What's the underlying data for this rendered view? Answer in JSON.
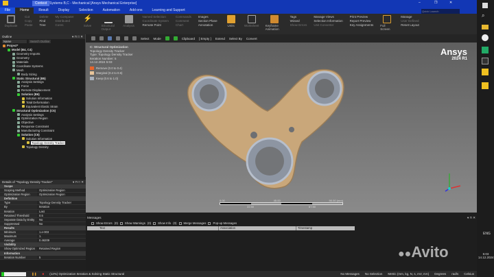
{
  "window": {
    "title": "Systems B,C - Mechanical [Ansys Mechanical Enterprise]",
    "context_tab": "Context",
    "quick_launch_placeholder": "Quick Launch"
  },
  "menu_tabs": [
    "File",
    "Home",
    "Result",
    "Display",
    "Selection",
    "Automation",
    "Add-ons",
    "Learning and Support"
  ],
  "ribbon": {
    "outline_group": {
      "label": "Outline",
      "items": [
        "Duplicate",
        "Cut",
        "Copy",
        "Paste",
        "Delete",
        "Find",
        "Tree"
      ]
    },
    "solve_group": {
      "label": "Solve",
      "items": [
        "My Computer",
        "Distributed",
        "Cores",
        "Solve",
        "Structural Output",
        "Analysis"
      ]
    },
    "insert_group": {
      "label": "Insert",
      "items": [
        "Named Selection",
        "Coordinate System",
        "Remote Point",
        "Commands",
        "Comment",
        "Chart",
        "Images",
        "Section Plane",
        "Annotation"
      ]
    },
    "tools_group": {
      "label": "Tools",
      "items": [
        "Units",
        "Worksheet",
        "Keyframe Animation",
        "Tags",
        "Wizard",
        "Show Errors",
        "Manage Views",
        "Selection Information",
        "Unit Converter",
        "Print Preview",
        "Report Preview",
        "Key Assignments"
      ]
    },
    "layout_group": {
      "label": "Layout",
      "items": [
        "Full Screen",
        "Manage",
        "User Defined",
        "Reset Layout"
      ]
    }
  },
  "toolbar": {
    "select": "Select",
    "mode": "Mode",
    "clipboard": "Clipboard",
    "empty": "[ Empty ]",
    "extend": "Extend",
    "select_by": "Select By",
    "convert": "Convert"
  },
  "outline": {
    "title": "Outline",
    "name_filter": "Name",
    "search_placeholder": "Search Outline",
    "tree": [
      {
        "label": "Project*",
        "level": 0,
        "bold": true
      },
      {
        "label": "Model (B4, C4)",
        "level": 1,
        "bold": true
      },
      {
        "label": "Geometry Imports",
        "level": 2
      },
      {
        "label": "Geometry",
        "level": 2
      },
      {
        "label": "Materials",
        "level": 2
      },
      {
        "label": "Coordinate Systems",
        "level": 2
      },
      {
        "label": "Mesh",
        "level": 2
      },
      {
        "label": "Body Sizing",
        "level": 3
      },
      {
        "label": "Static Structural (B5)",
        "level": 2,
        "bold": true
      },
      {
        "label": "Analysis Settings",
        "level": 3
      },
      {
        "label": "Force",
        "level": 3
      },
      {
        "label": "Remote Displacement",
        "level": 3
      },
      {
        "label": "Solution (B6)",
        "level": 3,
        "bold": true
      },
      {
        "label": "Solution Information",
        "level": 4
      },
      {
        "label": "Total Deformation",
        "level": 4
      },
      {
        "label": "Equivalent Elastic Strain",
        "level": 4
      },
      {
        "label": "Structural Optimization (C5)",
        "level": 2,
        "bold": true
      },
      {
        "label": "Analysis Settings",
        "level": 3
      },
      {
        "label": "Optimization Region",
        "level": 3
      },
      {
        "label": "Objective",
        "level": 3
      },
      {
        "label": "Response Constraint",
        "level": 3
      },
      {
        "label": "Manufacturing Constraint",
        "level": 3
      },
      {
        "label": "Solution (C6)",
        "level": 3,
        "bold": true
      },
      {
        "label": "Solution Information",
        "level": 4
      },
      {
        "label": "Topology Density Tracker",
        "level": 5,
        "selected": true
      },
      {
        "label": "Topology Density",
        "level": 4
      }
    ]
  },
  "details": {
    "title": "Details of \"Topology Density Tracker\"",
    "sections": [
      {
        "name": "Scope",
        "rows": [
          [
            "Scoping Method",
            "Optimization Region"
          ],
          [
            "Optimization Region",
            "Optimization Region"
          ]
        ]
      },
      {
        "name": "Definition",
        "rows": [
          [
            "Type",
            "Topology Density Tracker"
          ],
          [
            "By",
            "Iteration"
          ],
          [
            "Iteration",
            "Last"
          ],
          [
            "Retained Threshold",
            "0.5"
          ],
          [
            "Separate Data by Entity",
            "No"
          ],
          [
            "Suppressed",
            "No"
          ]
        ]
      },
      {
        "name": "Results",
        "rows": [
          [
            "Minimum",
            "1.e-003"
          ],
          [
            "Maximum",
            "1."
          ],
          [
            "Average",
            "0.46209"
          ]
        ]
      },
      {
        "name": "Visibility",
        "rows": [
          [
            "Show Optimized Region",
            "Retained Region"
          ]
        ]
      },
      {
        "name": "Information",
        "rows": [
          [
            "Iteration Number",
            "5"
          ]
        ]
      }
    ]
  },
  "viewport": {
    "header": [
      "C: Structural Optimization",
      "Topology Density Tracker",
      "Type: Topology Density Tracker",
      "Iteration Number: 5",
      "14.12.2024 5:03"
    ],
    "legend": [
      {
        "label": "Remove (0.0 to 0.4)",
        "color": "#e8642a"
      },
      {
        "label": "Marginal (0.4 to 0.6)",
        "color": "#e8c49a"
      },
      {
        "label": "Keep (0.6 to 1.0)",
        "color": "#a9b1bd"
      }
    ],
    "brand": "Ansys",
    "version": "2024 R1",
    "scale": {
      "top": [
        "0.00",
        "45.00",
        "90.00 (mm)"
      ],
      "bottom": [
        "22.50",
        "67.50"
      ]
    },
    "model_color": "#c9a77a"
  },
  "messages": {
    "title": "Messages",
    "filters": [
      "Show Errors",
      "(0)",
      "Show Warnings",
      "(0)",
      "Show Info",
      "(0)",
      "Merge Messages",
      "Pop-up Messages"
    ],
    "columns": [
      "Text",
      "Association",
      "Timestamp"
    ]
  },
  "status": {
    "progress": 0.12,
    "text": "(12%) Optimization Iteration & Solving Static Structural",
    "messages": "No Messages",
    "selection": "No Selection",
    "units": "Metric (mm, kg, N, s, mV, mA)",
    "angle": "Degrees",
    "rate": "rad/s",
    "temp": "Celsius"
  },
  "taskbar": {
    "lang": "ENG",
    "time": "5:03",
    "date": "14.12.2024"
  },
  "watermark": "Avito"
}
